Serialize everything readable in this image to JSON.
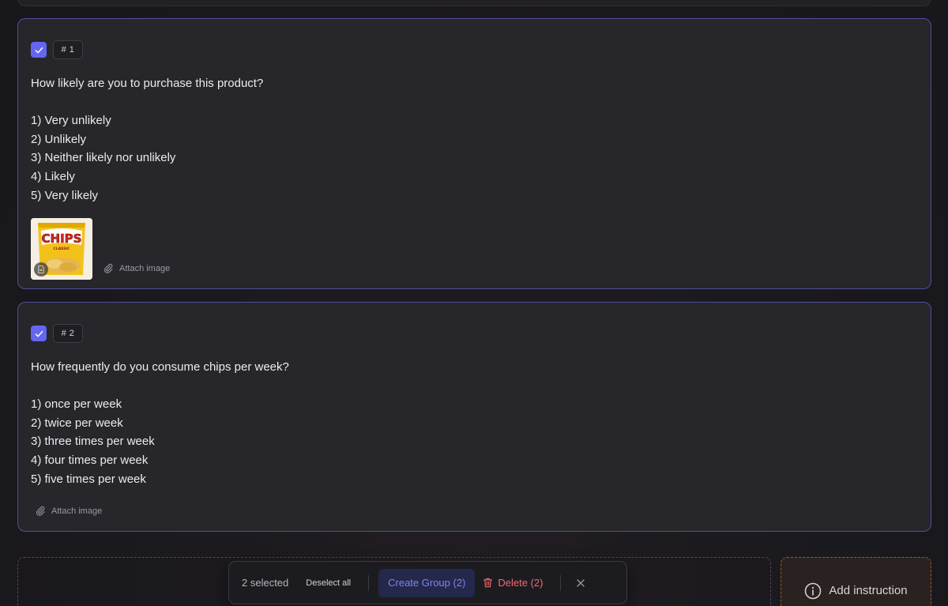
{
  "questions": [
    {
      "number": "# 1",
      "selected": true,
      "title": "How likely are you to purchase this product?",
      "options": [
        "1) Very unlikely",
        "2) Unlikely",
        "3) Neither likely nor unlikely",
        "4) Likely",
        "5) Very likely"
      ],
      "image_brand": "CHIPS",
      "image_sub": "CLASSIC",
      "attach_label": "Attach image"
    },
    {
      "number": "# 2",
      "selected": true,
      "title": "How frequently do you consume chips per week?",
      "options": [
        "1) once per week",
        "2) twice per week",
        "3) three times per week",
        "4) four times per week",
        "5) five times per week"
      ],
      "attach_label": "Attach image"
    }
  ],
  "action_bar": {
    "selected_text": "2 selected",
    "deselect_label": "Deselect all",
    "create_group_label": "Create Group (2)",
    "delete_label": "Delete (2)"
  },
  "add_instruction_label": "Add instruction",
  "colors": {
    "accent": "#6366f1",
    "card_border": "#4f4f9c",
    "danger": "#f06a6a",
    "instruction_border": "#9a5a2a"
  }
}
